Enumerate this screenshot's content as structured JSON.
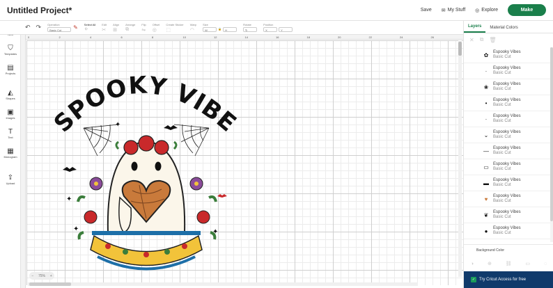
{
  "app": {
    "project_title": "Untitled Project*",
    "save_label": "Save",
    "my_stuff_label": "My Stuff",
    "explore_label": "Explore",
    "make_label": "Make",
    "brand_color": "#1a7f4b"
  },
  "sidebar": {
    "items": [
      {
        "label": "New",
        "icon": "plus-circle-icon"
      },
      {
        "label": "Templates",
        "icon": "shirt-icon"
      },
      {
        "label": "Projects",
        "icon": "projects-icon"
      },
      {
        "label": "Shapes",
        "icon": "shapes-icon"
      },
      {
        "label": "Images",
        "icon": "image-icon"
      },
      {
        "label": "Text",
        "icon": "text-icon"
      },
      {
        "label": "Monogram",
        "icon": "monogram-icon"
      },
      {
        "label": "Upload",
        "icon": "upload-icon"
      }
    ]
  },
  "toolbar": {
    "operation_label": "Operation",
    "operation_value": "Basic Cut",
    "select_all_label": "Select All",
    "edit_label": "Edit",
    "align_label": "Align",
    "arrange_label": "Arrange",
    "flip_label": "Flip",
    "offset_label": "Offset",
    "create_sticker_label": "Create Sticker",
    "warp_label": "Warp",
    "size_label": "Size",
    "rotate_label": "Rotate",
    "position_label": "Position"
  },
  "ruler": {
    "marks": [
      "0",
      "2",
      "4",
      "6",
      "8",
      "10",
      "12",
      "14",
      "16",
      "18",
      "20",
      "22",
      "24",
      "26"
    ]
  },
  "canvas": {
    "zoom": "75%",
    "artwork_title": "ESPOOKY VIBES"
  },
  "panel": {
    "tabs": [
      "Layers",
      "Material Colors"
    ],
    "layers": [
      {
        "name": "Espooky Vibes",
        "type": "Basic Cut"
      },
      {
        "name": "Espooky Vibes",
        "type": "Basic Cut"
      },
      {
        "name": "Espooky Vibes",
        "type": "Basic Cut"
      },
      {
        "name": "Espooky Vibes",
        "type": "Basic Cut"
      },
      {
        "name": "Espooky Vibes",
        "type": "Basic Cut"
      },
      {
        "name": "Espooky Vibes",
        "type": "Basic Cut"
      },
      {
        "name": "Espooky Vibes",
        "type": "Basic Cut"
      },
      {
        "name": "Espooky Vibes",
        "type": "Basic Cut"
      },
      {
        "name": "Espooky Vibes",
        "type": "Basic Cut"
      },
      {
        "name": "Espooky Vibes",
        "type": "Basic Cut"
      },
      {
        "name": "Espooky Vibes",
        "type": "Basic Cut"
      },
      {
        "name": "Espooky Vibes",
        "type": "Basic Cut"
      }
    ],
    "background_color_label": "Background Color",
    "access_label": "Try Cricut Access for free"
  }
}
